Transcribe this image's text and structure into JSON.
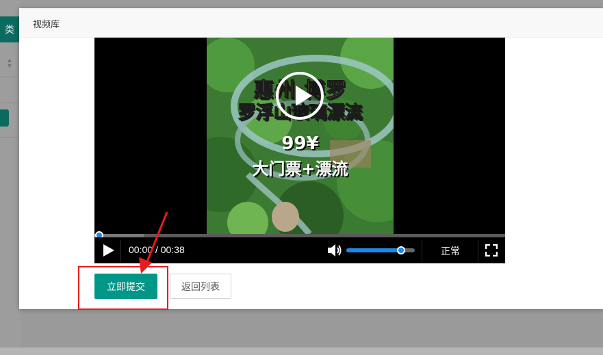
{
  "background": {
    "tab_label": "类"
  },
  "modal": {
    "title": "视频库"
  },
  "video": {
    "overlay": {
      "line1": "惠州·博罗",
      "line2": "罗浮山玻璃漂流",
      "line3": "99¥",
      "line4": "大门票+漂流"
    },
    "progress_fraction": 0.0,
    "buffer_fraction": 0.12,
    "time_display": "00:00 / 00:38",
    "current_time": "00:00",
    "duration": "00:38",
    "volume_fraction": 0.8,
    "speed_label": "正常",
    "icons": {
      "play": "play-icon",
      "big_play": "big-play-icon",
      "volume": "volume-icon",
      "fullscreen": "fullscreen-icon"
    }
  },
  "buttons": {
    "submit_label": "立即提交",
    "back_label": "返回列表"
  },
  "colors": {
    "primary": "#009688",
    "annotation": "#e81c1c",
    "player_accent": "#1e88e5"
  }
}
